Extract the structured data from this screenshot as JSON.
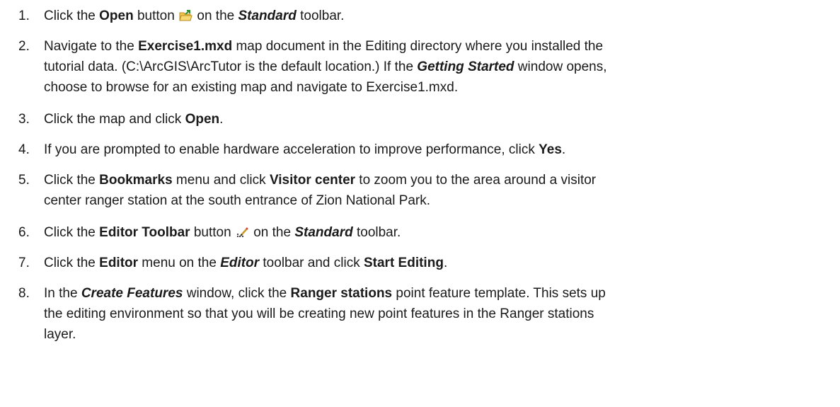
{
  "steps": [
    {
      "num": "1.",
      "parts": [
        "Click the ",
        "Open",
        " button ",
        " on the ",
        "Standard",
        " toolbar."
      ]
    },
    {
      "num": "2.",
      "parts": [
        "Navigate to the ",
        "Exercise1.mxd",
        " map document in the Editing directory where you installed the",
        "tutorial data. (C:\\ArcGIS\\ArcTutor is the default location.) If the ",
        "Getting Started",
        " window opens,",
        "choose to browse for an existing map and navigate to Exercise1.mxd."
      ]
    },
    {
      "num": "3.",
      "parts": [
        "Click the map and click ",
        "Open",
        "."
      ]
    },
    {
      "num": "4.",
      "parts": [
        "If you are prompted to enable hardware acceleration to improve performance, click ",
        "Yes",
        "."
      ]
    },
    {
      "num": "5.",
      "parts": [
        "Click the ",
        "Bookmarks",
        " menu and click ",
        "Visitor center",
        " to zoom you to the area around a visitor",
        "center ranger station at the south entrance of Zion National Park."
      ]
    },
    {
      "num": "6.",
      "parts": [
        "Click the ",
        "Editor Toolbar",
        " button ",
        " on the ",
        "Standard",
        " toolbar."
      ]
    },
    {
      "num": "7.",
      "parts": [
        "Click the ",
        "Editor",
        " menu on the ",
        "Editor",
        " toolbar and click ",
        "Start Editing",
        "."
      ]
    },
    {
      "num": "8.",
      "parts": [
        "In the ",
        "Create Features",
        " window, click the ",
        "Ranger stations",
        " point feature template. This sets up",
        "the editing environment so that you will be creating new point features in the Ranger stations",
        "layer."
      ]
    }
  ],
  "icons": {
    "open": "open-folder-icon",
    "editor_toolbar": "editor-toolbar-icon"
  }
}
